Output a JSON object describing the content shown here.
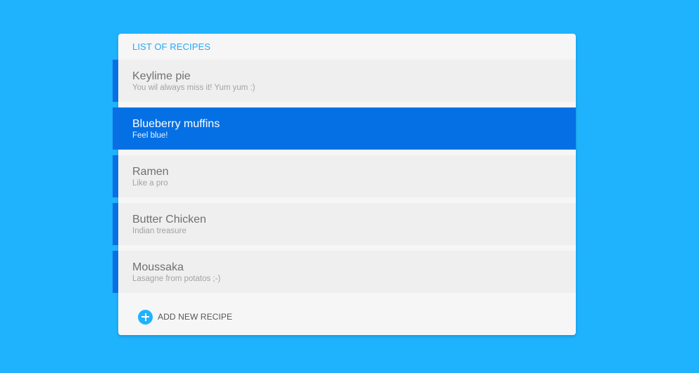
{
  "colors": {
    "background": "#1fb3fd",
    "accent": "#0570e4",
    "header_text": "#29a8f0"
  },
  "header": {
    "title": "LIST OF RECIPES"
  },
  "recipes": [
    {
      "title": "Keylime pie",
      "subtitle": "You wil always miss it! Yum yum :)",
      "selected": false
    },
    {
      "title": "Blueberry muffins",
      "subtitle": "Feel blue!",
      "selected": true
    },
    {
      "title": "Ramen",
      "subtitle": "Like a pro",
      "selected": false
    },
    {
      "title": "Butter Chicken",
      "subtitle": "Indian treasure",
      "selected": false
    },
    {
      "title": "Moussaka",
      "subtitle": "Lasagne from potatos ;-)",
      "selected": false
    }
  ],
  "actions": {
    "add_label": "ADD NEW RECIPE",
    "add_icon": "plus-circle-icon"
  }
}
